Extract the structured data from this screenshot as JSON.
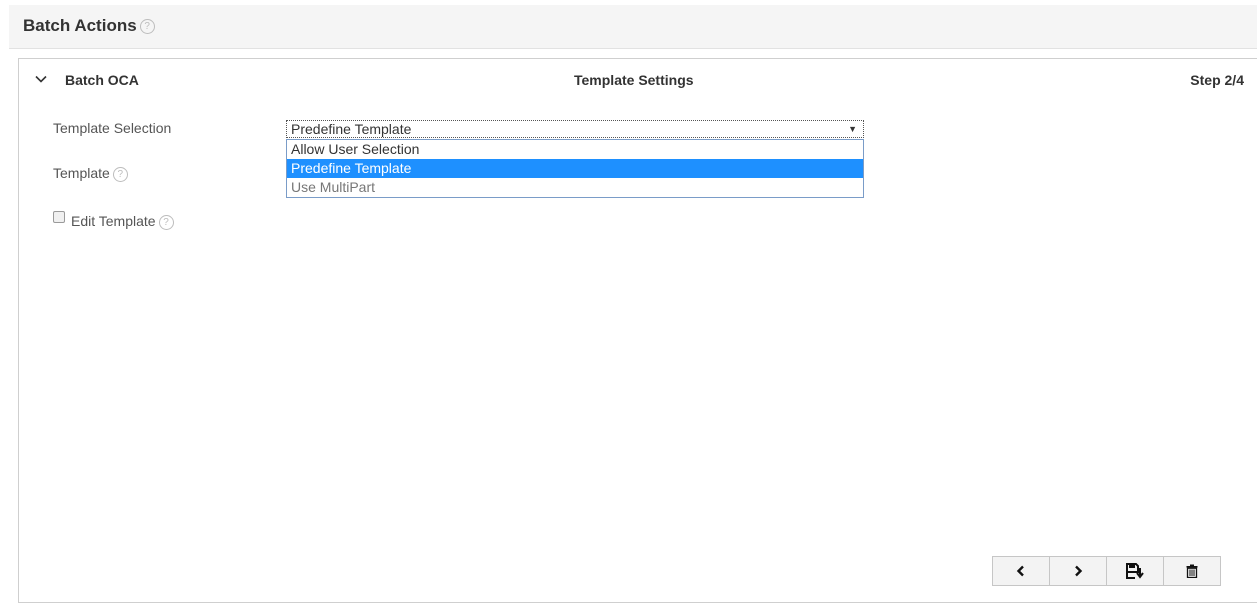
{
  "header": {
    "title": "Batch Actions",
    "help_glyph": "?"
  },
  "panel": {
    "name": "Batch OCA",
    "center_title": "Template Settings",
    "step": "Step 2/4",
    "collapse_icon": "chevron-down-icon"
  },
  "form": {
    "template_selection_label": "Template Selection",
    "template_label": "Template",
    "edit_template_label": "Edit Template",
    "help_glyph": "?",
    "select": {
      "value": "Predefine Template",
      "arrow": "▼",
      "options": [
        "Allow User Selection",
        "Predefine Template",
        "Use MultiPart"
      ],
      "selected_index": 1
    },
    "edit_template_checked": false
  },
  "toolbar": {
    "buttons": [
      "previous-icon",
      "next-icon",
      "save-icon",
      "delete-icon"
    ]
  },
  "colors": {
    "accent": "#1e90ff",
    "header_bg": "#f5f5f5"
  }
}
